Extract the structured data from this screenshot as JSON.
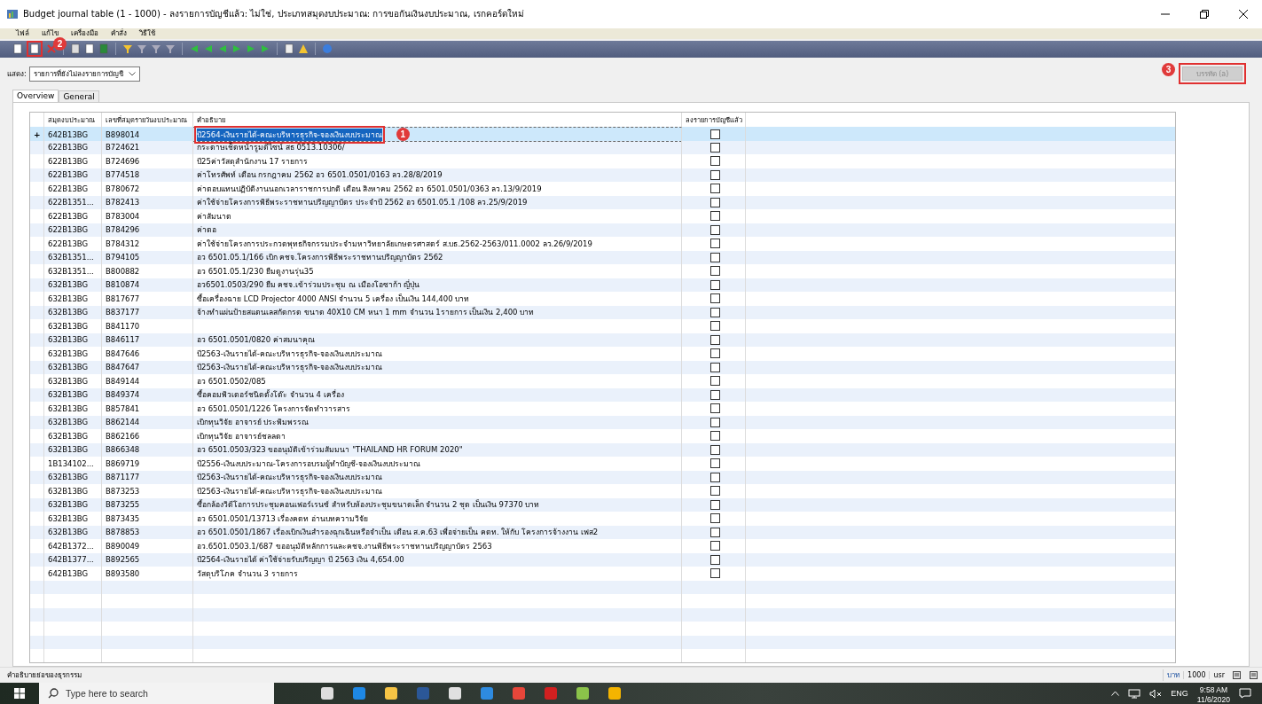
{
  "window": {
    "title": "Budget journal table (1 - 1000) - ลงรายการบัญชีแล้ว: ไม่ใช่, ประเภทสมุดงบประมาณ: การขอกันเงินงบประมาณ, เรกคอร์ดใหม่"
  },
  "menu": [
    "ไฟล์",
    "แก้ไข",
    "เครื่องมือ",
    "คำสั่ง",
    "วิธีใช้"
  ],
  "filter": {
    "label": "แสดง:",
    "value": "รายการที่ยังไม่ลงรายการบัญชี"
  },
  "post_button": {
    "label": "บรรทัด (a)",
    "disabled": true
  },
  "callouts": [
    "1",
    "2",
    "3"
  ],
  "tabs": [
    {
      "label": "Overview",
      "selected": true
    },
    {
      "label": "General",
      "selected": false
    }
  ],
  "table": {
    "columns": [
      "สมุดงบประมาณ",
      "เลขที่สมุดรายวันงบประมาณ",
      "คำอธิบาย",
      "ลงรายการบัญชีแล้ว"
    ],
    "rows": [
      {
        "marker": "+",
        "selected": true,
        "cells": [
          "642B13BG",
          "B898014",
          "ปี2564-เงินรายได้-คณะบริหารธุรกิจ-จองเงินงบประมาณ"
        ],
        "posted": false
      },
      {
        "selected": false,
        "cells": [
          "622B13BG",
          "B724621",
          "กระดาษเช็ดหน้ารูมดีไซน์ สธ 0513.10306/"
        ],
        "posted": false
      },
      {
        "selected": false,
        "cells": [
          "622B13BG",
          "B724696",
          "ปี25ค่าวัสดุสำนักงาน 17 รายการ"
        ],
        "posted": false
      },
      {
        "selected": false,
        "cells": [
          "622B13BG",
          "B774518",
          "ค่าโทรศัพท์ เดือน กรกฎาคม 2562 อว 6501.0501/0163 ลว.28/8/2019"
        ],
        "posted": false
      },
      {
        "selected": false,
        "cells": [
          "622B13BG",
          "B780672",
          "ค่าตอบแทนปฏิบัติงานนอกเวลาราชการปกติ เดือน สิงหาคม 2562 อว 6501.0501/0363 ลว.13/9/2019"
        ],
        "posted": false
      },
      {
        "selected": false,
        "cells": [
          "622B1351...",
          "B782413",
          "ค่าใช้จ่ายโครงการพิธีพระราชทานปริญญาบัตร ประจำปี 2562 อว 6501.05.1 /108 ลว.25/9/2019"
        ],
        "posted": false
      },
      {
        "selected": false,
        "cells": [
          "622B13BG",
          "B783004",
          "ค่าสัมนาต"
        ],
        "posted": false
      },
      {
        "selected": false,
        "cells": [
          "622B13BG",
          "B784296",
          "ค่าตอ"
        ],
        "posted": false
      },
      {
        "selected": false,
        "cells": [
          "622B13BG",
          "B784312",
          "ค่าใช้จ่ายโครงการประกวดพุทธกิจกรรมประจำมหาวิทยาลัยเกษตรศาสตร์ ส.บธ.2562-2563/011.0002 ลว.26/9/2019"
        ],
        "posted": false
      },
      {
        "selected": false,
        "cells": [
          "632B1351...",
          "B794105",
          "อว 6501.05.1/166  เบิก คชจ.โครงการพิธีพระราชทานปริญญาบัตร 2562"
        ],
        "posted": false
      },
      {
        "selected": false,
        "cells": [
          "632B1351...",
          "B800882",
          "อว 6501.05.1/230 ยืมดูงานรุ่น35"
        ],
        "posted": false
      },
      {
        "selected": false,
        "cells": [
          "632B13BG",
          "B810874",
          "อว6501.0503/290 ยืม คชจ.เข้าร่วมประชุม ณ เมืองโอซาก้า ญี่ปุ่น"
        ],
        "posted": false
      },
      {
        "selected": false,
        "cells": [
          "632B13BG",
          "B817677",
          "ซื้อเครื่องฉาย LCD Projector 4000 ANSI  จำนวน 5 เครื่อง เป็นเงิน 144,400 บาท"
        ],
        "posted": false
      },
      {
        "selected": false,
        "cells": [
          "632B13BG",
          "B837177",
          "จ้างทำแผ่นป้ายสแตนเลสกัดกรด ขนาด 40X10 CM  หนา 1 mm จำนวน 1รายการ เป็นเงิน 2,400 บาท"
        ],
        "posted": false
      },
      {
        "selected": false,
        "cells": [
          "632B13BG",
          "B841170",
          ""
        ],
        "posted": false
      },
      {
        "selected": false,
        "cells": [
          "632B13BG",
          "B846117",
          "อว 6501.0501/0820 ค่าสมนาคุณ"
        ],
        "posted": false
      },
      {
        "selected": false,
        "cells": [
          "632B13BG",
          "B847646",
          "ปี2563-เงินรายได้-คณะบริหารธุรกิจ-จองเงินงบประมาณ"
        ],
        "posted": false
      },
      {
        "selected": false,
        "cells": [
          "632B13BG",
          "B847647",
          "ปี2563-เงินรายได้-คณะบริหารธุรกิจ-จองเงินงบประมาณ"
        ],
        "posted": false
      },
      {
        "selected": false,
        "cells": [
          "632B13BG",
          "B849144",
          "อว 6501.0502/085"
        ],
        "posted": false
      },
      {
        "selected": false,
        "cells": [
          "632B13BG",
          "B849374",
          "ซื้อคอมพิวเตอร์ชนิดตั้งโต๊ะ จำนวน 4 เครื่อง"
        ],
        "posted": false
      },
      {
        "selected": false,
        "cells": [
          "632B13BG",
          "B857841",
          "อว 6501.0501/1226 โครงการจัดทำวารสาร"
        ],
        "posted": false
      },
      {
        "selected": false,
        "cells": [
          "632B13BG",
          "B862144",
          "เบิกทุนวิจัย อาจารย์ ประพิมพรรณ"
        ],
        "posted": false
      },
      {
        "selected": false,
        "cells": [
          "632B13BG",
          "B862166",
          "เบิกทุนวิจัย อาจารย์ชลลดา"
        ],
        "posted": false
      },
      {
        "selected": false,
        "cells": [
          "632B13BG",
          "B866348",
          "อว 6501.0503/323 ขออนุมัติเข้าร่วมสัมมนา \"THAILAND HR FORUM 2020\""
        ],
        "posted": false
      },
      {
        "selected": false,
        "cells": [
          "1B134102...",
          "B869719",
          "ปี2556-เงินงบประมาณ-โครงการอบรมผู้ทำบัญชี-จองเงินงบประมาณ"
        ],
        "posted": false
      },
      {
        "selected": false,
        "cells": [
          "632B13BG",
          "B871177",
          "ปี2563-เงินรายได้-คณะบริหารธุรกิจ-จองเงินงบประมาณ"
        ],
        "posted": false
      },
      {
        "selected": false,
        "cells": [
          "632B13BG",
          "B873253",
          "ปี2563-เงินรายได้-คณะบริหารธุรกิจ-จองเงินงบประมาณ"
        ],
        "posted": false
      },
      {
        "selected": false,
        "cells": [
          "632B13BG",
          "B873255",
          "ซื้อกล้องวิดีโอการประชุมคอนเฟอร์เรนซ์ สำหรับห้องประชุมขนาดเล็ก จำนวน 2 ชุด เป็นเงิน 97370 บาท"
        ],
        "posted": false
      },
      {
        "selected": false,
        "cells": [
          "632B13BG",
          "B873435",
          "อว 6501.0501/13713 เรื่องคตท อ่านบทความวิจัย"
        ],
        "posted": false
      },
      {
        "selected": false,
        "cells": [
          "632B13BG",
          "B878853",
          "อว 6501.0501/1867 เรื่องเบิกเงินสำรองฉุกเฉินหรือจำเป็น เดือน ส.ค.63 เพื่อจ่ายเป็น คตท. ให้กับ โครงการจ้างงาน เฟส2"
        ],
        "posted": false
      },
      {
        "selected": false,
        "cells": [
          "642B1372...",
          "B890049",
          "อว.6501.0503.1/687 ขออนุมัติหลักการและคชจ.งานพิธีพระราชทานปริญญาบัตร 2563"
        ],
        "posted": false
      },
      {
        "selected": false,
        "cells": [
          "642B1377...",
          "B892565",
          "ปี2564-เงินรายได้  ค่าใช้จ่ายรับปริญญา ปี 2563 เงิน 4,654.00"
        ],
        "posted": false
      },
      {
        "selected": false,
        "cells": [
          "642B13BG",
          "B893580",
          "วัสดุบริโภค จำนวน 3 รายการ"
        ],
        "posted": false
      }
    ]
  },
  "status_bar": {
    "help": "คำอธิบายย่อของธุรกรรม",
    "fields": [
      "บาท",
      "1000",
      "usr"
    ]
  },
  "taskbar": {
    "search_placeholder": "Type here to search",
    "language": "ENG",
    "time": "9:58 AM",
    "date": "11/6/2020"
  }
}
